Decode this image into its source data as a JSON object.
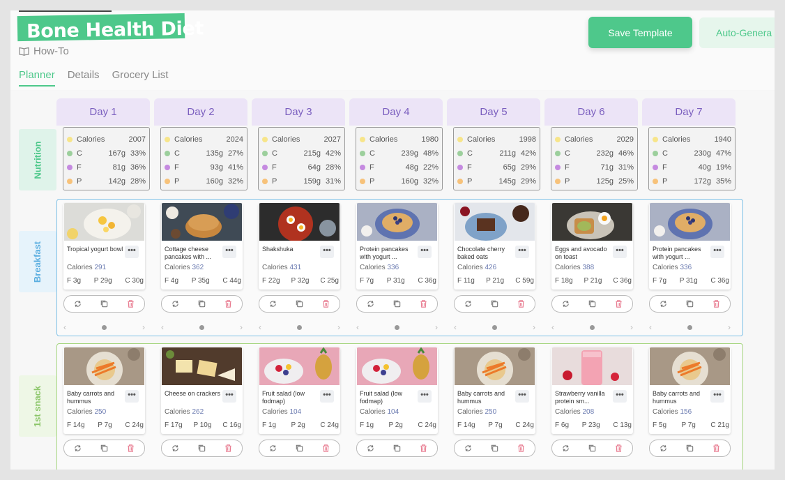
{
  "header": {
    "title": "Bone Health Diet",
    "howto_label": "How-To",
    "tabs": [
      "Planner",
      "Details",
      "Grocery List"
    ],
    "active_tab": "Planner",
    "save_button": "Save Template",
    "auto_button": "Auto-Genera"
  },
  "colors": {
    "accent": "#4ec88b",
    "day_header_bg": "#ece4f7",
    "day_header_text": "#7b5fbf",
    "calories_dot": "#f7e58a",
    "carbs_dot": "#9ccf9c",
    "fat_dot": "#c58ae0",
    "protein_dot": "#f7c27a"
  },
  "row_labels": {
    "nutrition": "Nutrition",
    "breakfast": "Breakfast",
    "snack": "1st snack"
  },
  "days": [
    {
      "label": "Day 1",
      "nutrition": {
        "calories": "2007",
        "c_g": "167g",
        "c_pct": "33%",
        "f_g": "81g",
        "f_pct": "36%",
        "p_g": "142g",
        "p_pct": "28%"
      }
    },
    {
      "label": "Day 2",
      "nutrition": {
        "calories": "2024",
        "c_g": "135g",
        "c_pct": "27%",
        "f_g": "93g",
        "f_pct": "41%",
        "p_g": "160g",
        "p_pct": "32%"
      }
    },
    {
      "label": "Day 3",
      "nutrition": {
        "calories": "2027",
        "c_g": "215g",
        "c_pct": "42%",
        "f_g": "64g",
        "f_pct": "28%",
        "p_g": "159g",
        "p_pct": "31%"
      }
    },
    {
      "label": "Day 4",
      "nutrition": {
        "calories": "1980",
        "c_g": "239g",
        "c_pct": "48%",
        "f_g": "48g",
        "f_pct": "22%",
        "p_g": "160g",
        "p_pct": "32%"
      }
    },
    {
      "label": "Day 5",
      "nutrition": {
        "calories": "1998",
        "c_g": "211g",
        "c_pct": "42%",
        "f_g": "65g",
        "f_pct": "29%",
        "p_g": "145g",
        "p_pct": "29%"
      }
    },
    {
      "label": "Day 6",
      "nutrition": {
        "calories": "2029",
        "c_g": "232g",
        "c_pct": "46%",
        "f_g": "71g",
        "f_pct": "31%",
        "p_g": "125g",
        "p_pct": "25%"
      }
    },
    {
      "label": "Day 7",
      "nutrition": {
        "calories": "1940",
        "c_g": "230g",
        "c_pct": "47%",
        "f_g": "40g",
        "f_pct": "19%",
        "p_g": "172g",
        "p_pct": "35%"
      }
    }
  ],
  "nutrition_labels": {
    "calories": "Calories",
    "c": "C",
    "f": "F",
    "p": "P"
  },
  "calories_prefix": "Calories",
  "menu_glyph": "•••",
  "breakfast": [
    {
      "name": "Tropical yogurt bowl",
      "calories": "291",
      "f": "F 3g",
      "p": "P 29g",
      "c": "C 30g",
      "img": "yogurt-bowl"
    },
    {
      "name": "Cottage cheese pancakes with ...",
      "calories": "362",
      "f": "F 4g",
      "p": "P 35g",
      "c": "C 44g",
      "img": "pancakes"
    },
    {
      "name": "Shakshuka",
      "calories": "431",
      "f": "F 22g",
      "p": "P 32g",
      "c": "C 25g",
      "img": "shakshuka"
    },
    {
      "name": "Protein pancakes with yogurt ...",
      "calories": "336",
      "f": "F 7g",
      "p": "P 31g",
      "c": "C 36g",
      "img": "blueberry-pancakes"
    },
    {
      "name": "Chocolate cherry baked oats",
      "calories": "426",
      "f": "F 11g",
      "p": "P 21g",
      "c": "C 59g",
      "img": "chocolate-oats"
    },
    {
      "name": "Eggs and avocado on toast",
      "calories": "388",
      "f": "F 18g",
      "p": "P 21g",
      "c": "C 36g",
      "img": "avocado-toast"
    },
    {
      "name": "Protein pancakes with yogurt ...",
      "calories": "336",
      "f": "F 7g",
      "p": "P 31g",
      "c": "C 36g",
      "img": "blueberry-pancakes"
    }
  ],
  "snack": [
    {
      "name": "Baby carrots and hummus",
      "calories": "250",
      "f": "F 14g",
      "p": "P 7g",
      "c": "C 24g",
      "img": "carrots-hummus"
    },
    {
      "name": "Cheese on crackers",
      "calories": "262",
      "f": "F 17g",
      "p": "P 10g",
      "c": "C 16g",
      "img": "cheese-crackers"
    },
    {
      "name": "Fruit salad (low fodmap)",
      "calories": "104",
      "f": "F 1g",
      "p": "P 2g",
      "c": "C 24g",
      "img": "fruit-salad"
    },
    {
      "name": "Fruit salad (low fodmap)",
      "calories": "104",
      "f": "F 1g",
      "p": "P 2g",
      "c": "C 24g",
      "img": "fruit-salad"
    },
    {
      "name": "Baby carrots and hummus",
      "calories": "250",
      "f": "F 14g",
      "p": "P 7g",
      "c": "C 24g",
      "img": "carrots-hummus"
    },
    {
      "name": "Strawberry vanilla protein sm...",
      "calories": "208",
      "f": "F 6g",
      "p": "P 23g",
      "c": "C 13g",
      "img": "strawberry-smoothie"
    },
    {
      "name": "Baby carrots and hummus",
      "calories": "156",
      "f": "F 5g",
      "p": "P 7g",
      "c": "C 21g",
      "img": "carrots-hummus"
    }
  ],
  "icons": {
    "book": "book-icon",
    "swap": "swap-icon",
    "copy": "copy-icon",
    "delete": "trash-icon",
    "prev": "chevron-left-icon",
    "next": "chevron-right-icon",
    "more": "more-icon"
  }
}
